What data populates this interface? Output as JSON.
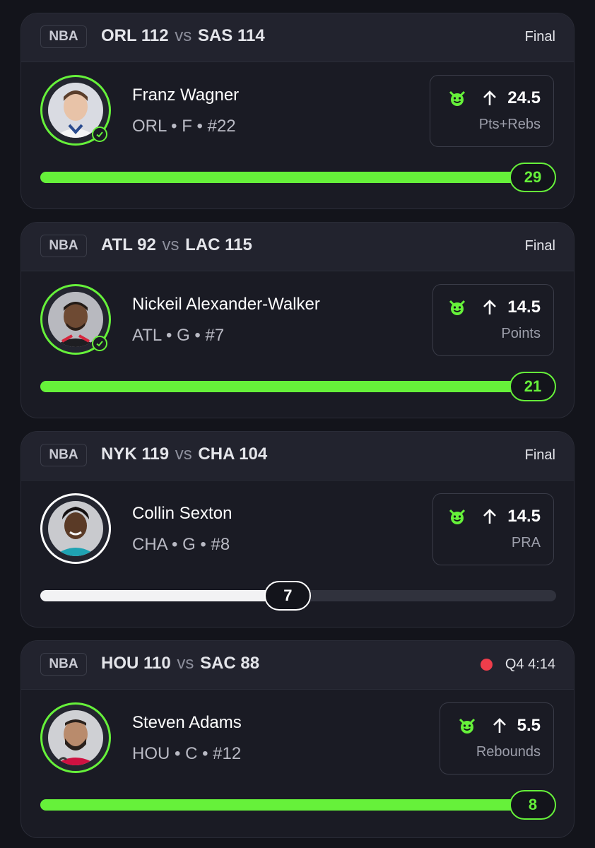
{
  "colors": {
    "accent": "#66f13a",
    "live": "#ef3d4b",
    "background": "#13141b",
    "card": "#1a1b24"
  },
  "cards": [
    {
      "league": "NBA",
      "away_team": "ORL",
      "away_score": "112",
      "vs": "vs",
      "home_team": "SAS",
      "home_score": "114",
      "status": "Final",
      "live": false,
      "player": "Franz Wagner",
      "meta": "ORL • F • #22",
      "prop_icon": "devil-icon",
      "direction": "up-arrow-icon",
      "line": "24.5",
      "stat": "Pts+Rebs",
      "result": "29",
      "progress": 1.0,
      "hit": true
    },
    {
      "league": "NBA",
      "away_team": "ATL",
      "away_score": "92",
      "vs": "vs",
      "home_team": "LAC",
      "home_score": "115",
      "status": "Final",
      "live": false,
      "player": "Nickeil Alexander-Walker",
      "meta": "ATL • G • #7",
      "prop_icon": "devil-icon",
      "direction": "up-arrow-icon",
      "line": "14.5",
      "stat": "Points",
      "result": "21",
      "progress": 1.0,
      "hit": true
    },
    {
      "league": "NBA",
      "away_team": "NYK",
      "away_score": "119",
      "vs": "vs",
      "home_team": "CHA",
      "home_score": "104",
      "status": "Final",
      "live": false,
      "player": "Collin Sexton",
      "meta": "CHA • G • #8",
      "prop_icon": "devil-icon",
      "direction": "up-arrow-icon",
      "line": "14.5",
      "stat": "PRA",
      "result": "7",
      "progress": 0.48,
      "hit": false
    },
    {
      "league": "NBA",
      "away_team": "HOU",
      "away_score": "110",
      "vs": "vs",
      "home_team": "SAC",
      "home_score": "88",
      "status": "Q4 4:14",
      "live": true,
      "player": "Steven Adams",
      "meta": "HOU • C • #12",
      "prop_icon": "devil-icon",
      "direction": "up-arrow-icon",
      "line": "5.5",
      "stat": "Rebounds",
      "result": "8",
      "progress": 1.0,
      "hit": true
    }
  ]
}
